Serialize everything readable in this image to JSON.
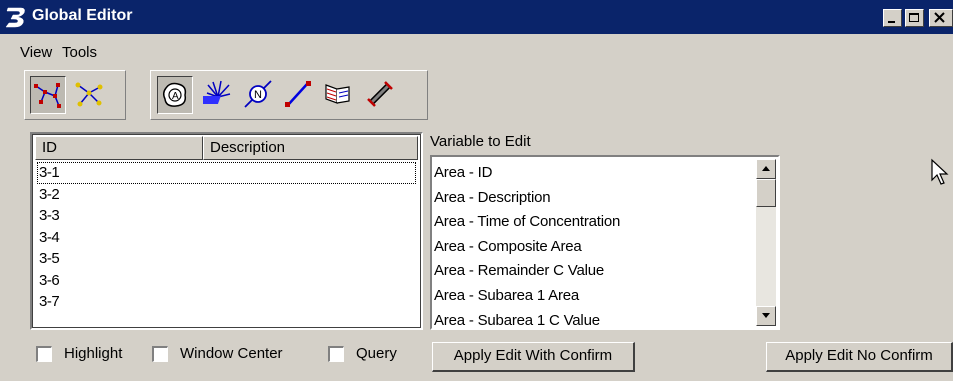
{
  "window": {
    "title": "Global Editor",
    "app_icon": "bentley-b-icon",
    "controls": [
      "minimize-icon",
      "maximize-icon",
      "close-icon"
    ]
  },
  "menu": {
    "view": "View",
    "tools": "Tools"
  },
  "toolbar": {
    "group1": [
      {
        "icon": "select-network-icon",
        "pressed": true
      },
      {
        "icon": "select-nodes-icon",
        "pressed": false
      }
    ],
    "group2": [
      {
        "icon": "area-icon",
        "pressed": true
      },
      {
        "icon": "inlet-icon",
        "pressed": false
      },
      {
        "icon": "node-icon",
        "pressed": false
      },
      {
        "icon": "link-icon",
        "pressed": false
      },
      {
        "icon": "outlet-icon",
        "pressed": false
      },
      {
        "icon": "pipe-icon",
        "pressed": false
      }
    ]
  },
  "element_list": {
    "columns": [
      "ID",
      "Description"
    ],
    "rows": [
      "3-1",
      "3-2",
      "3-3",
      "3-4",
      "3-5",
      "3-6",
      "3-7"
    ],
    "focused_row": "3-1"
  },
  "variables": {
    "label": "Variable to Edit",
    "items": [
      "Area - ID",
      "Area - Description",
      "Area - Time of Concentration",
      "Area - Composite Area",
      "Area - Remainder C Value",
      "Area - Subarea 1 Area",
      "Area - Subarea 1 C Value"
    ]
  },
  "options": {
    "highlight": {
      "label": "Highlight",
      "checked": false
    },
    "window_center": {
      "label": "Window Center",
      "checked": false
    },
    "query": {
      "label": "Query",
      "checked": false
    }
  },
  "buttons": {
    "apply_confirm": "Apply Edit With Confirm",
    "apply_no_confirm": "Apply Edit No Confirm"
  },
  "colors": {
    "titlebar": "#0a246a",
    "face": "#d4d0c8",
    "window": "#ffffff"
  }
}
